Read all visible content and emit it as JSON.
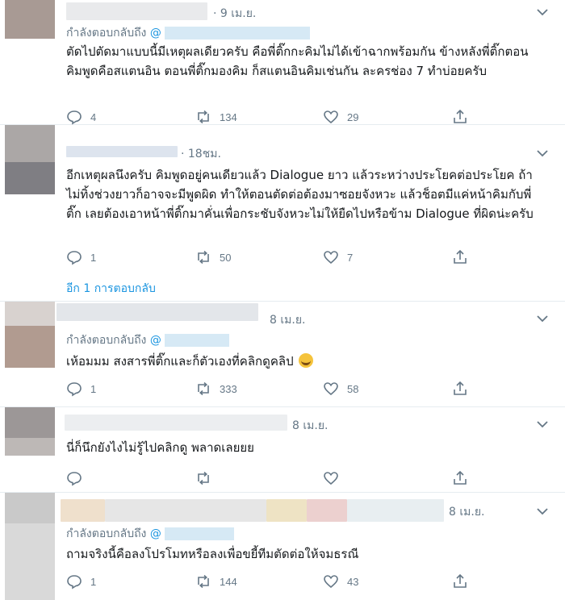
{
  "tweets": [
    {
      "time": "· 9 เม.ย.",
      "reply_prefix": "กำลังตอบกลับถึง",
      "reply_handle": "@",
      "text": "ตัดไปตัดมาแบบนี้มีเหตุผลเดียวครับ คือพี่ติ๊กกะคิมไม่ได้เข้าฉากพร้อมกัน ข้างหลังพี่ติ๊กตอนคิมพูดคือสแตนอิน ตอนพี่ติ๊กมองคิม ก็สแตนอินคิมเช่นกัน ละครช่อง 7 ทำบ่อยครับ",
      "replies": "4",
      "retweets": "134",
      "likes": "29"
    },
    {
      "time": "· 18ชม.",
      "text": "อีกเหตุผลนึงครับ คิมพูดอยู่คนเดียวแล้ว Dialogue ยาว แล้วระหว่างประโยคต่อประโยค ถ้าไม่ทิ้งช่วงยาวก็อาจจะมีพูดผิด ทำให้ตอนตัดต่อต้องมาซอยจังหวะ แล้วช็อตมีแค่หน้าคิมกับพี่ติ๊ก เลยต้องเอาหน้าพี่ติ๊กมาคั่นเพื่อกระชับจังหวะไม่ให้ยืดไปหรือข้าม Dialogue ที่ผิดน่ะครับ",
      "replies": "1",
      "retweets": "50",
      "likes": "7",
      "more_replies": "อีก 1 การตอบกลับ"
    },
    {
      "time": "8 เม.ย.",
      "reply_prefix": "กำลังตอบกลับถึง",
      "reply_handle": "@",
      "text": "เห้อมมม สงสารพี่ติ๊กและก็ตัวเองที่คลิกดูคลิป",
      "replies": "1",
      "retweets": "333",
      "likes": "58"
    },
    {
      "time": "8 เม.ย.",
      "text": "นี่ก็นึกยังไงไม่รู้ไปคลิกดู พลาดเลยยย",
      "replies": "",
      "retweets": "",
      "likes": ""
    },
    {
      "time": "8 เม.ย.",
      "reply_prefix": "กำลังตอบกลับถึง",
      "reply_handle": "@",
      "text": "ถามจริงนี้คือลงโปรโมทหรือลงเพื่อขยี้ทีมตัดต่อให้จมธรณี",
      "replies": "1",
      "retweets": "144",
      "likes": "43"
    }
  ],
  "colors": {
    "link": "#1b95e0",
    "muted": "#657786",
    "divider": "#e6ecf0"
  }
}
